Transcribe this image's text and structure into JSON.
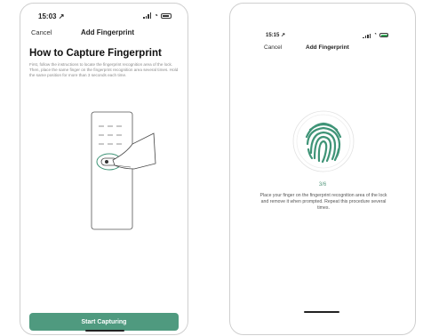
{
  "left_screen": {
    "status": {
      "time": "15:03",
      "location_arrow": "↗"
    },
    "nav": {
      "cancel": "Cancel",
      "title": "Add Fingerprint"
    },
    "heading": "How to Capture Fingerprint",
    "instructions": "First, follow the instructions to locate the fingerprint recognition area of the lock. Then, place the same finger on the fingerprint recognition area several times. Hold the same position for more than 3 seconds each time.",
    "start_button": "Start Capturing",
    "accent_color": "#4f9a7f"
  },
  "right_screen": {
    "status": {
      "time": "15:15",
      "location_arrow": "↗"
    },
    "nav": {
      "cancel": "Cancel",
      "title": "Add Fingerprint"
    },
    "progress": "3/6",
    "prompt": "Place your finger on the fingerprint recognition area of the lock and remove it when prompted. Repeat this procedure several times.",
    "fingerprint_color": "#3f9477"
  },
  "icons": [
    "location-arrow-icon",
    "signal-icon",
    "wifi-icon",
    "battery-icon",
    "fingerprint-icon",
    "lock-illustration"
  ]
}
